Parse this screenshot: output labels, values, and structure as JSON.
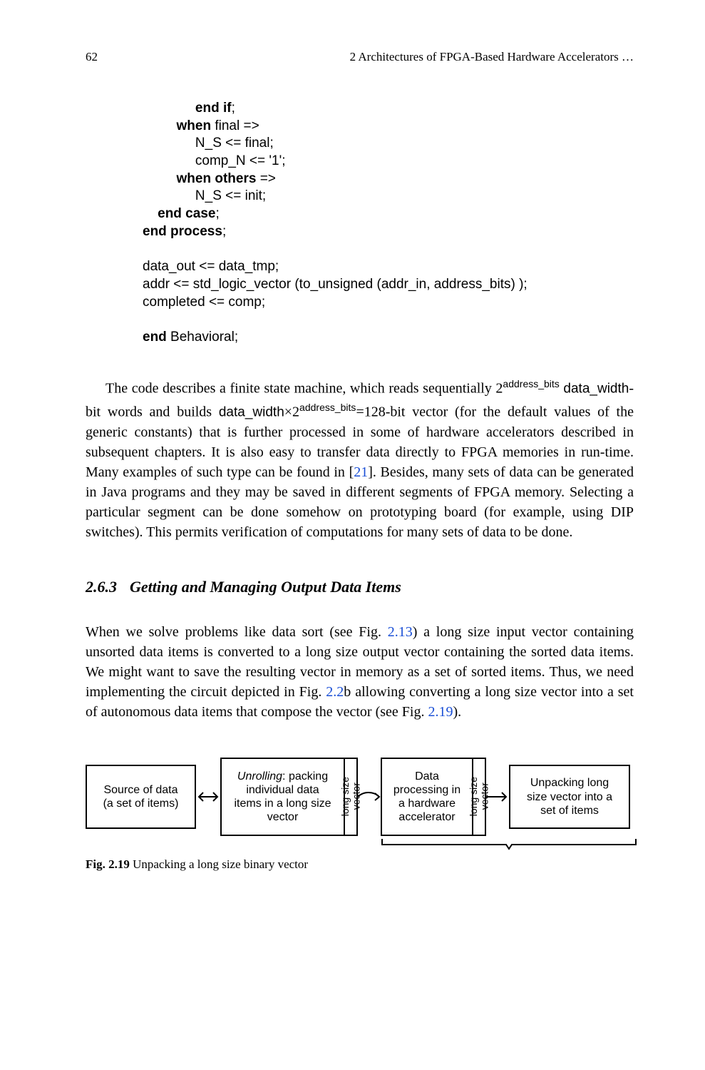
{
  "header": {
    "pageNumber": "62",
    "runningTitle": "2   Architectures of FPGA-Based Hardware Accelerators …"
  },
  "code": {
    "l1a": "end if",
    "l1b": ";",
    "l2a": "when",
    "l2b": " final =>",
    "l3": "N_S <= final;",
    "l4": "comp_N <= '1';",
    "l5a": "when others",
    "l5b": " =>",
    "l6": "N_S <= init;",
    "l7a": "end case",
    "l7b": ";",
    "l8a": "end process",
    "l8b": ";",
    "l9": "data_out <= data_tmp;",
    "l10": "addr <= std_logic_vector (to_unsigned (addr_in, address_bits) );",
    "l11": "completed <= comp;",
    "l12a": "end",
    "l12b": " Behavioral;"
  },
  "para1": {
    "t1": "The code describes a finite state machine, which reads sequentially 2",
    "sup1": "address_bits",
    "t2": " ",
    "sans1": "data_width",
    "t3": "-bit words and builds ",
    "sans2": "data_width",
    "t4": "×2",
    "sup2": "address_bits",
    "t5": "=128-bit vector (for the default values of the generic constants) that is further processed in some of hardware accelerators described in subsequent chapters. It is also easy to transfer data directly to FPGA memories in run-time. Many examples of such type can be found in [",
    "cite": "21",
    "t6": "]. Besides, many sets of data can be generated in Java programs and they may be saved in different segments of FPGA memory. Selecting a particular segment can be done somehow on prototyping board (for example, using DIP switches). This permits verification of computations for many sets of data to be done."
  },
  "section": {
    "number": "2.6.3",
    "title": "Getting and Managing Output Data Items"
  },
  "para2": {
    "t1": "When we solve problems like data sort (see Fig. ",
    "cite1": "2.13",
    "t2": ") a long size input vector containing unsorted data items is converted to a long size output vector containing the sorted data items. We might want to save the resulting vector in memory as a set of sorted items. Thus, we need implementing the circuit depicted in Fig. ",
    "cite2": "2.2",
    "t3": "b allowing converting a long size vector into a set of autonomous data items that compose the vector (see Fig. ",
    "cite3": "2.19",
    "t4": ")."
  },
  "figure": {
    "box1l1": "Source of data",
    "box1l2": "(a set of items)",
    "box2l1i": "Unrolling",
    "box2l1": ": packing",
    "box2l2": "individual data",
    "box2l3": "items in a long size",
    "box2l4": "vector",
    "vlabel1a": "long size",
    "vlabel1b": "vector",
    "box3l1": "Data",
    "box3l2": "processing in",
    "box3l3": "a hardware",
    "box3l4": "accelerator",
    "vlabel2a": "long size",
    "vlabel2b": "vector",
    "box4l1": "Unpacking long",
    "box4l2": "size vector into a",
    "box4l3": "set of items",
    "captionBold": "Fig. 2.19",
    "captionRest": "   Unpacking a long size binary vector"
  }
}
